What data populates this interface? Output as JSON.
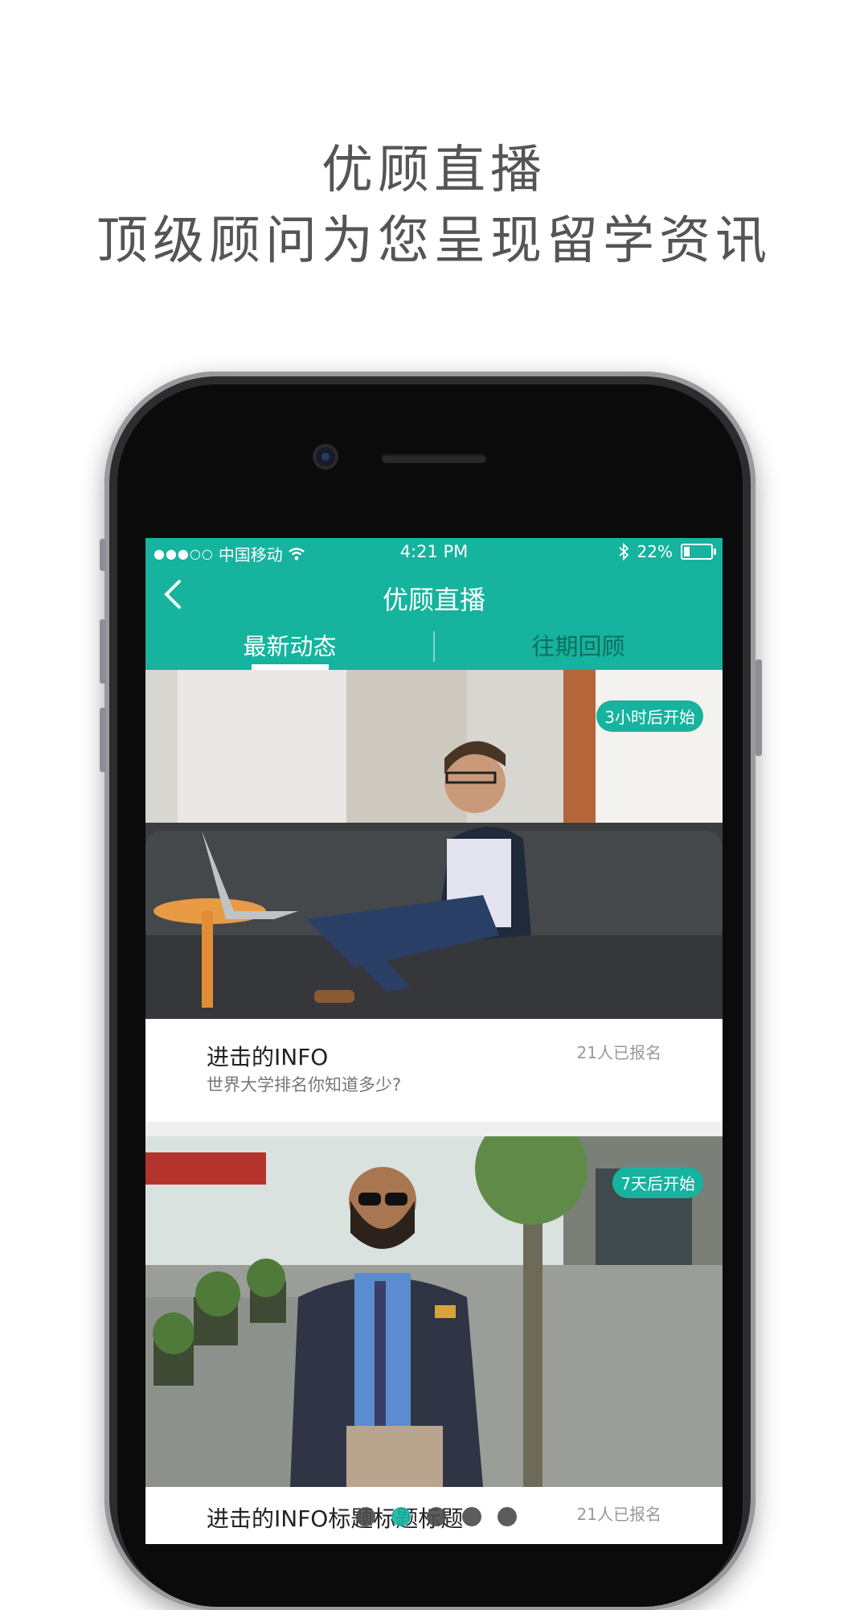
{
  "headline": {
    "line1": "优顾直播",
    "line2": "顶级顾问为您呈现留学资讯"
  },
  "status_bar": {
    "signal": "●●●○○",
    "carrier": "中国移动",
    "time": "4:21 PM",
    "battery": "22%",
    "battery_level": 0.22
  },
  "nav": {
    "title": "优顾直播",
    "back_icon": "chevron-left-icon"
  },
  "tabs": [
    {
      "label": "最新动态",
      "active": true
    },
    {
      "label": "往期回顾",
      "active": false
    }
  ],
  "cards": [
    {
      "badge": "3小时后开始",
      "title": "进击的INFO",
      "subtitle": "世界大学排名你知道多少?",
      "count": "21人已报名"
    },
    {
      "badge": "7天后开始",
      "title": "进击的INFO标题标题标题",
      "count": "21人已报名"
    }
  ],
  "pager": {
    "total": 5,
    "active_index": 1
  },
  "colors": {
    "accent": "#16b39e",
    "headline": "#555555"
  }
}
